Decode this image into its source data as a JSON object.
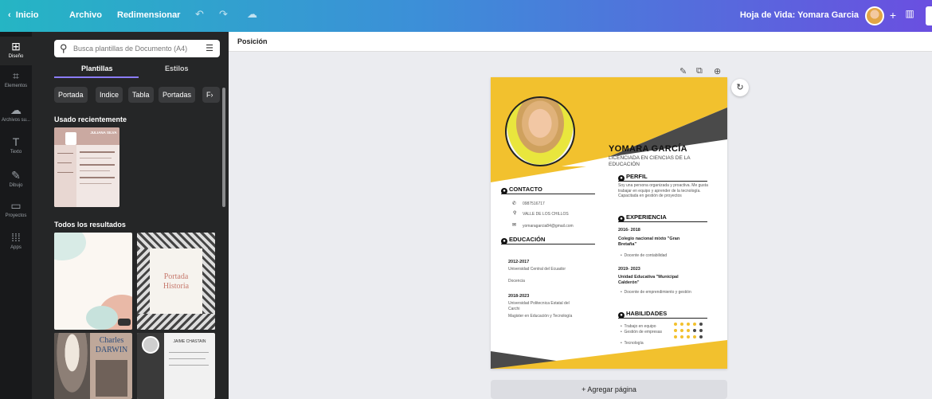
{
  "topbar": {
    "home": "Inicio",
    "file": "Archivo",
    "resize": "Redimensionar",
    "doc_title": "Hoja de Vida: Yomara Garcia"
  },
  "rail": [
    {
      "label": "Diseño",
      "icon": "layout-icon"
    },
    {
      "label": "Elementos",
      "icon": "shapes-icon"
    },
    {
      "label": "Archivos su...",
      "icon": "upload-icon"
    },
    {
      "label": "Texto",
      "icon": "text-icon"
    },
    {
      "label": "Dibujo",
      "icon": "draw-icon"
    },
    {
      "label": "Proyectos",
      "icon": "folder-icon"
    },
    {
      "label": "Apps",
      "icon": "apps-icon"
    }
  ],
  "panel": {
    "search_placeholder": "Busca plantillas de Documento (A4)",
    "tabs": [
      "Plantillas",
      "Estilos"
    ],
    "chips": [
      "Portada",
      "Indice",
      "Tabla",
      "Portadas"
    ],
    "recent_title": "Usado recientemente",
    "all_title": "Todos los resultados",
    "thumb_recent_name": "JULIANA SILVA",
    "thumb_portada_1": "Portada",
    "thumb_portada_2": "Historia",
    "thumb_charles_1": "Charles",
    "thumb_charles_2": "DARWIN",
    "thumb_jaime": "JAIME CHASTAIN"
  },
  "canvas": {
    "position_label": "Posición",
    "add_page": "+ Agregar página"
  },
  "resume": {
    "name": "YOMARA GARCÍA",
    "title": "LICENCIADA EN CIENCIAS DE LA EDUCACIÓN",
    "perfil_head": "PERFIL",
    "perfil_text": "Soy una persona organizada y proactiva. Me gusta trabajar en equipo y aprender de la tecnología. Capacitada en gestión de proyectos",
    "contacto_head": "CONTACTO",
    "phone": "0987516717",
    "address": "VALLE DE LOS CHILLOS",
    "email": "yomaragarcia84@gmail.com",
    "educacion_head": "EDUCACIÓN",
    "edu": [
      {
        "years": "2012-2017",
        "place": "Universidad Central del Ecuador",
        "degree": "Docencia"
      },
      {
        "years": "2018-2023",
        "place": "Universidad Politecnica Estatal del Carchi",
        "degree": "Magister en Educación y Tecnología"
      }
    ],
    "experiencia_head": "EXPERIENCIA",
    "exp": [
      {
        "years": "2016- 2018",
        "place": "Colegio nacional mixto \"Gran Bretaña\"",
        "role": "Docente de contabilidad"
      },
      {
        "years": "2019- 2023",
        "place": "Unidad Educativa \"Municipal Calderón\"",
        "role": "Docente de emprendimiento y gestión"
      }
    ],
    "habilidades_head": "HABILIDADES",
    "skills": [
      "Trabajo en equipo",
      "Gestión de empresas",
      "Tecnología"
    ],
    "colors": {
      "yellow": "#f2c12e",
      "dark": "#4a4a4a"
    }
  }
}
